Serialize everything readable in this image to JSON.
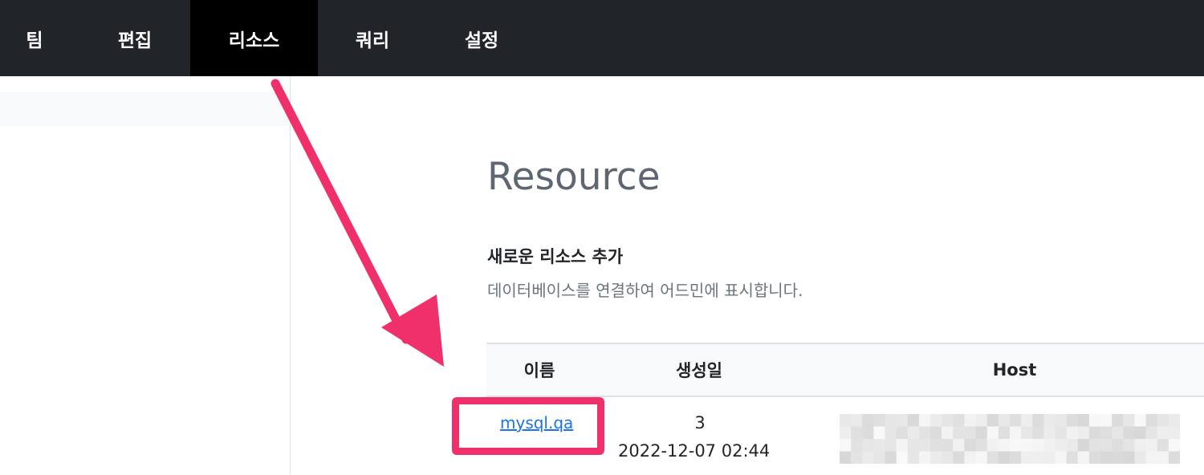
{
  "nav": {
    "items": [
      {
        "label": "팀"
      },
      {
        "label": "편집"
      },
      {
        "label": "리소스"
      },
      {
        "label": "쿼리"
      },
      {
        "label": "설정"
      }
    ],
    "active": "리소스"
  },
  "main": {
    "title": "Resource",
    "section_title": "새로운 리소스 추가",
    "section_desc": "데이터베이스를 연결하여 어드민에 표시합니다."
  },
  "table": {
    "headers": [
      "이름",
      "생성일",
      "Host"
    ],
    "rows": [
      {
        "name": "mysql.qa",
        "created_count": "3",
        "created_date": "2022-12-07 02:44",
        "host": "(blurred)"
      }
    ]
  },
  "colors": {
    "topbar": "#212529",
    "active_tab": "#000000",
    "annotation": "#f0306b",
    "link": "#1a73e8"
  },
  "icons": {
    "annotation_arrow": "arrow-icon"
  }
}
